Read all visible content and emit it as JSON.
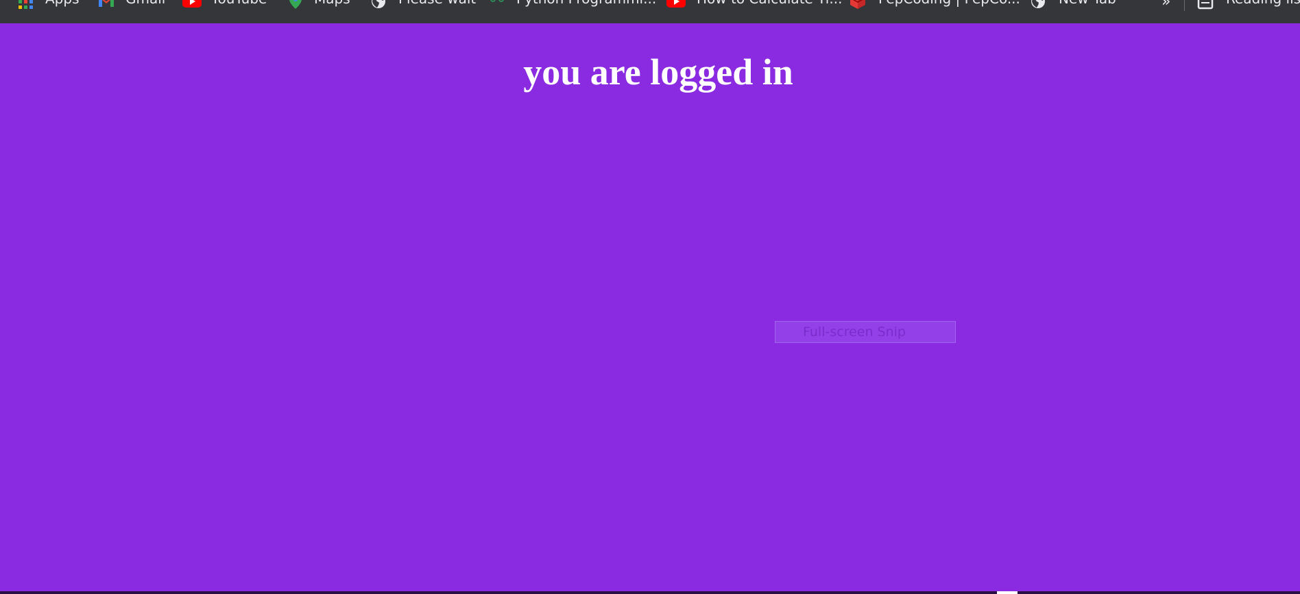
{
  "bookmarks": {
    "items": [
      {
        "label": "Apps",
        "icon": "apps-grid-icon"
      },
      {
        "label": "Gmail",
        "icon": "gmail-icon"
      },
      {
        "label": "YouTube",
        "icon": "youtube-icon"
      },
      {
        "label": "Maps",
        "icon": "maps-icon"
      },
      {
        "label": "Please wait",
        "icon": "globe-icon"
      },
      {
        "label": "Python Programmi...",
        "icon": "python-site-icon"
      },
      {
        "label": "How to Calculate Ti...",
        "icon": "youtube-icon"
      },
      {
        "label": "PepCoding | PepCo...",
        "icon": "pepcoding-icon"
      },
      {
        "label": "New Tab",
        "icon": "globe-icon"
      }
    ],
    "overflow_label": "»",
    "reading_list_label": "Reading list"
  },
  "page": {
    "heading": "you are logged in",
    "background_color": "#8a2be2"
  },
  "overlay": {
    "snip_tooltip": "Full-screen Snip"
  }
}
